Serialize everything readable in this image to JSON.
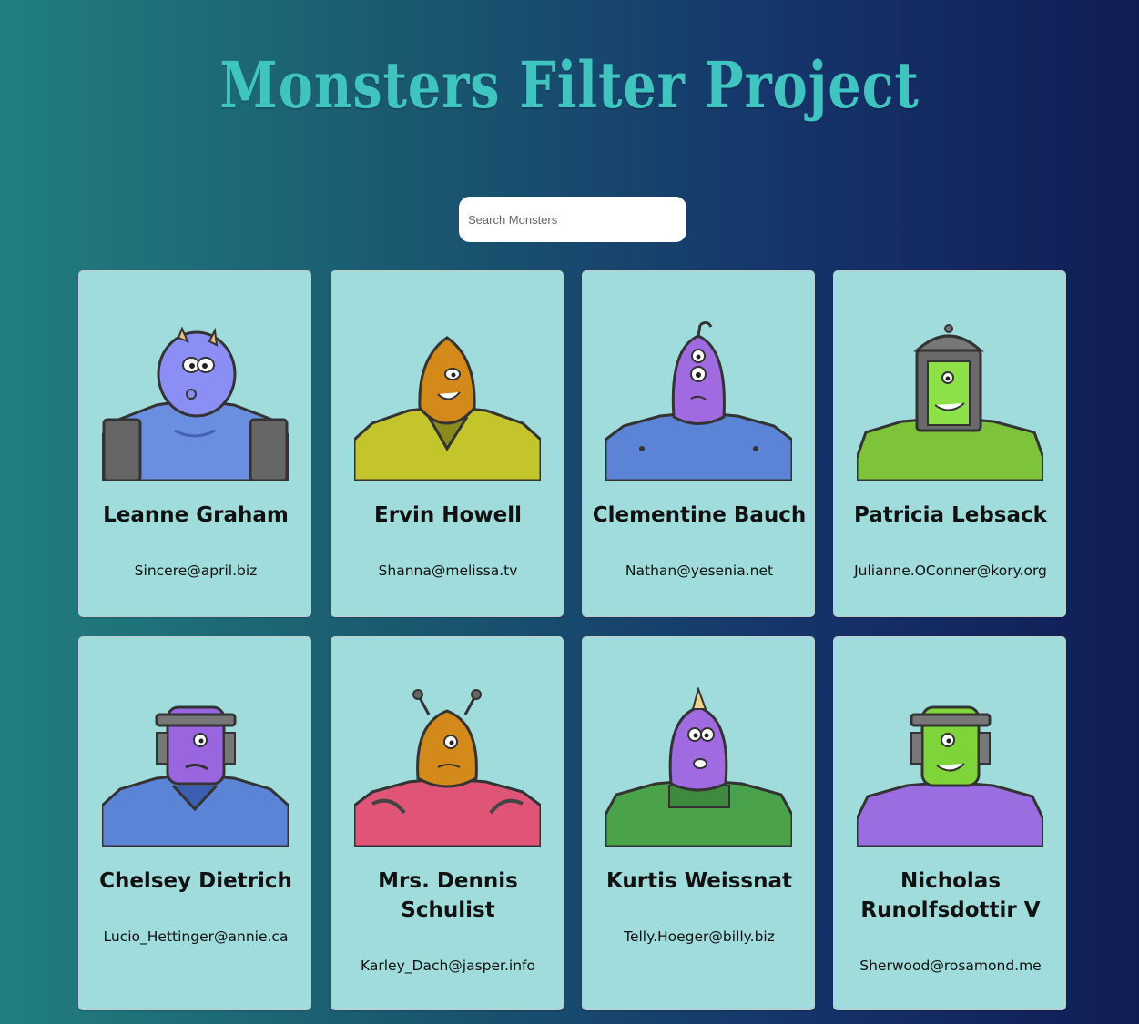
{
  "title": "Monsters Filter Project",
  "search": {
    "placeholder": "Search Monsters",
    "value": ""
  },
  "monsters": [
    {
      "name": "Leanne Graham",
      "email": "Sincere@april.biz"
    },
    {
      "name": "Ervin Howell",
      "email": "Shanna@melissa.tv"
    },
    {
      "name": "Clementine Bauch",
      "email": "Nathan@yesenia.net"
    },
    {
      "name": "Patricia Lebsack",
      "email": "Julianne.OConner@kory.org"
    },
    {
      "name": "Chelsey Dietrich",
      "email": "Lucio_Hettinger@annie.ca"
    },
    {
      "name": "Mrs. Dennis Schulist",
      "email": "Karley_Dach@jasper.info"
    },
    {
      "name": "Kurtis Weissnat",
      "email": "Telly.Hoeger@billy.biz"
    },
    {
      "name": "Nicholas Runolfsdottir V",
      "email": "Sherwood@rosamond.me"
    }
  ],
  "colors": {
    "background_start": "#217f7f",
    "background_end": "#111c54",
    "title": "#3fc4c0",
    "card": "#9fdcdb"
  }
}
